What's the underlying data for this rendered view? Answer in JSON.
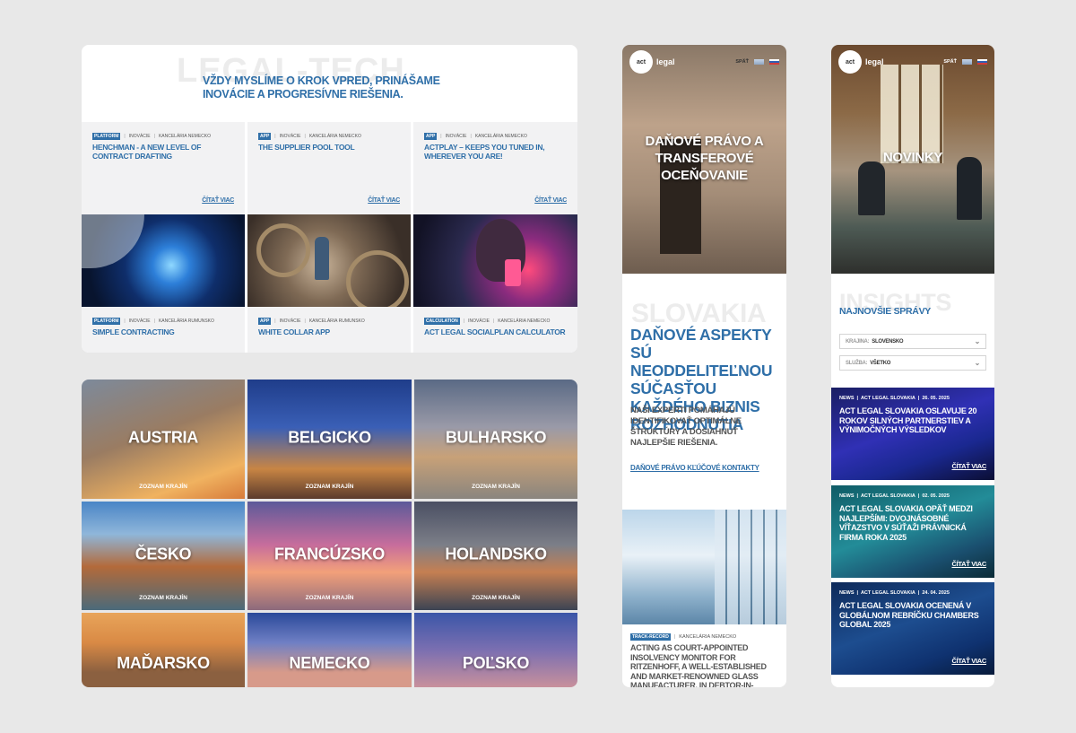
{
  "panel_tech": {
    "watermark": "LEGAL-TECH",
    "headline": "VŽDY MYSLÍME O KROK VPRED, PRINÁŠAME INOVÁCIE A PROGRESÍVNE RIEŠENIA.",
    "read_more": "ČÍTAŤ VIAC",
    "cards_top": [
      {
        "tag": "PLATFORM",
        "cat": "INOVÁCIE",
        "office": "KANCELÁRIA NEMECKO",
        "title": "HENCHMAN - A NEW LEVEL OF CONTRACT DRAFTING"
      },
      {
        "tag": "APP",
        "cat": "INOVÁCIE",
        "office": "KANCELÁRIA NEMECKO",
        "title": "THE SUPPLIER POOL TOOL"
      },
      {
        "tag": "APP",
        "cat": "INOVÁCIE",
        "office": "KANCELÁRIA NEMECKO",
        "title": "ACTPLAY – KEEPS YOU TUNED IN, WHEREVER YOU ARE!"
      }
    ],
    "cards_bottom": [
      {
        "tag": "PLATFORM",
        "cat": "INOVÁCIE",
        "office": "KANCELÁRIA RUMUNSKO",
        "title": "SIMPLE CONTRACTING"
      },
      {
        "tag": "APP",
        "cat": "INOVÁCIE",
        "office": "KANCELÁRIA RUMUNSKO",
        "title": "WHITE COLLAR APP"
      },
      {
        "tag": "CALCULATION",
        "cat": "INOVÁCIE",
        "office": "KANCELÁRIA NEMECKO",
        "title": "ACT LEGAL SOCIALPLAN CALCULATOR"
      }
    ]
  },
  "panel_countries": {
    "list_label": "ZOZNAM KRAJÍN",
    "countries": [
      "AUSTRIA",
      "BELGICKO",
      "BULHARSKO",
      "ČESKO",
      "FRANCÚZSKO",
      "HOLANDSKO",
      "MAĎARSKO",
      "NEMECKO",
      "POĽSKO"
    ]
  },
  "header": {
    "logo": "act",
    "logo_suffix": "legal",
    "back": "SPÄŤ"
  },
  "panel_tax": {
    "hero_title": "DAŇOVÉ PRÁVO A TRANSFEROVÉ OCEŇOVANIE",
    "watermark": "SLOVAKIA",
    "headline": "DAŇOVÉ ASPEKTY SÚ NEODDELITEĽNOU SÚČASŤOU KAŽDÉHO BIZNIS ROZHODNUTIA",
    "body": "NAŠI EXPERTI POMÁHAJÚ IDENTIFIKOVAŤ OPTIMÁLNE ŠTRUKTÚRY A DOSIAHNUŤ NAJLEPŠIE RIEŠENIA.",
    "link": "DAŇOVÉ PRÁVO KĽÚČOVÉ KONTAKTY",
    "card_tag": "TRACK-RECORD",
    "card_office": "KANCELÁRIA NEMECKO",
    "card_title": "ACTING AS COURT-APPOINTED INSOLVENCY MONITOR FOR RITZENHOFF, A WELL-ESTABLISHED AND MARKET-RENOWNED GLASS MANUFACTURER, IN DEBTOR-IN-"
  },
  "panel_news": {
    "hero_title": "NOVINKY",
    "watermark": "INSIGHTS",
    "heading": "NAJNOVŠIE SPRÁVY",
    "filter_country_label": "KRAJINA:",
    "filter_country_value": "SLOVENSKO",
    "filter_service_label": "SLUŽBA:",
    "filter_service_value": "VŠETKO",
    "read_more": "ČÍTAŤ VIAC",
    "items": [
      {
        "type": "NEWS",
        "source": "ACT LEGAL SLOVAKIA",
        "date": "26. 05. 2025",
        "title": "ACT LEGAL SLOVAKIA OSLAVUJE 20 ROKOV SILNÝCH PARTNERSTIEV A VÝNIMOČNÝCH VÝSLEDKOV"
      },
      {
        "type": "NEWS",
        "source": "ACT LEGAL SLOVAKIA",
        "date": "02. 05. 2025",
        "title": "ACT LEGAL SLOVAKIA OPÄŤ MEDZI NAJLEPŠÍMI: DVOJNÁSOBNÉ VÍŤAZSTVO V SÚŤAŽI PRÁVNICKÁ FIRMA ROKA 2025"
      },
      {
        "type": "NEWS",
        "source": "ACT LEGAL SLOVAKIA",
        "date": "24. 04. 2025",
        "title": "ACT LEGAL SLOVAKIA OCENENÁ V GLOBÁLNOM REBRÍČKU CHAMBERS GLOBAL 2025"
      }
    ]
  }
}
